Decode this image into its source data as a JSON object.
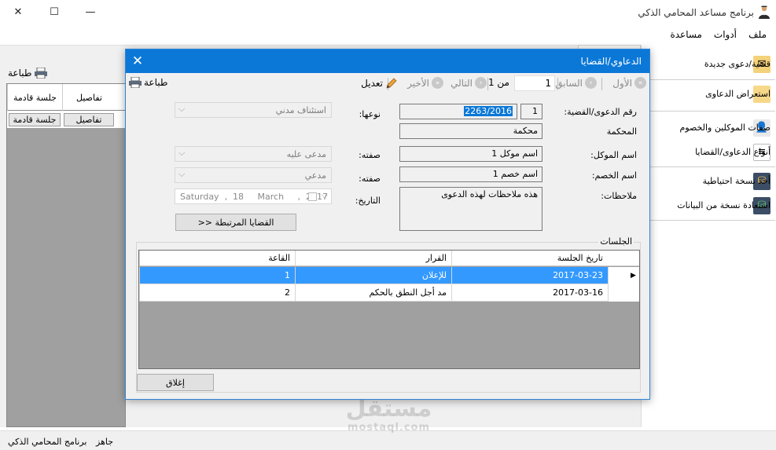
{
  "window": {
    "title": "برنامج مساعد المحامي الذكي",
    "close": "✕",
    "maximize": "☐",
    "minimize": "—"
  },
  "menu": [
    "ملف",
    "أدوات",
    "مساعدة"
  ],
  "background": {
    "print_label": "طباعة",
    "grid_headers": [
      "جلسة قادمة",
      "تفاصيل"
    ],
    "grid_buttons": [
      "جلسة قادمة",
      "تفاصيل"
    ]
  },
  "sidebar": {
    "items": [
      {
        "label": "قضية/دعوى جديدة",
        "icon": "new-case-icon"
      },
      {
        "label": "استعراض الدعاوى",
        "icon": "folder-icon"
      },
      {
        "label": "صفات الموكلين والخصوم",
        "icon": "person-icon"
      },
      {
        "label": "أنواع الدعاوى/القضايا",
        "icon": "document-icon"
      },
      {
        "label": "أخذ نسخة احتياطية",
        "icon": "database-backup-icon"
      },
      {
        "label": "استعادة نسخة من البيانات",
        "icon": "database-restore-icon"
      }
    ]
  },
  "status": {
    "ready": "جاهز",
    "app_name": "برنامج المحامي الذكي"
  },
  "watermark": {
    "arabic": "مستقل",
    "latin": "mostaql.com"
  },
  "dialog": {
    "title": "الدعاوي/القضايا",
    "toolbar": {
      "first": "الأول",
      "previous": "السابق",
      "position": "1",
      "of_total": "من 1",
      "next": "التالي",
      "last": "الأخير",
      "edit": "تعديل",
      "print": "طباعة"
    },
    "labels": {
      "case_number": "رقم الدعوى/القضية:",
      "court": "المحكمة",
      "client_name": "اسم الموكل:",
      "opponent_name": "اسم الخصم:",
      "notes": "ملاحظات:",
      "type": "نوعها:",
      "client_role": "صفته:",
      "opponent_role": "صفته:",
      "date": "التاريخ:"
    },
    "values": {
      "case_seq": "1",
      "case_number": "2263/2016",
      "court": "محكمة",
      "client_name": "اسم موكل 1",
      "opponent_name": "اسم خصم 1",
      "notes": "هذه ملاحظات لهذه الدعوى",
      "type": "استئناف مدني",
      "client_role": "مدعى عليه",
      "opponent_role": "مدعي",
      "date": "Saturday  ,  18     March     ,  2017"
    },
    "related_button": "القضايا المرتبطة <<",
    "sessions_title": "الجلسات",
    "sessions": {
      "headers": [
        "تاريخ الجلسة",
        "القرار",
        "القاعة"
      ],
      "rows": [
        {
          "date": "2017-03-23",
          "decision": "للإعلان",
          "hall": "1"
        },
        {
          "date": "2017-03-16",
          "decision": "مد أجل النطق بالحكم",
          "hall": "2"
        }
      ]
    },
    "close_button": "إغلاق"
  }
}
